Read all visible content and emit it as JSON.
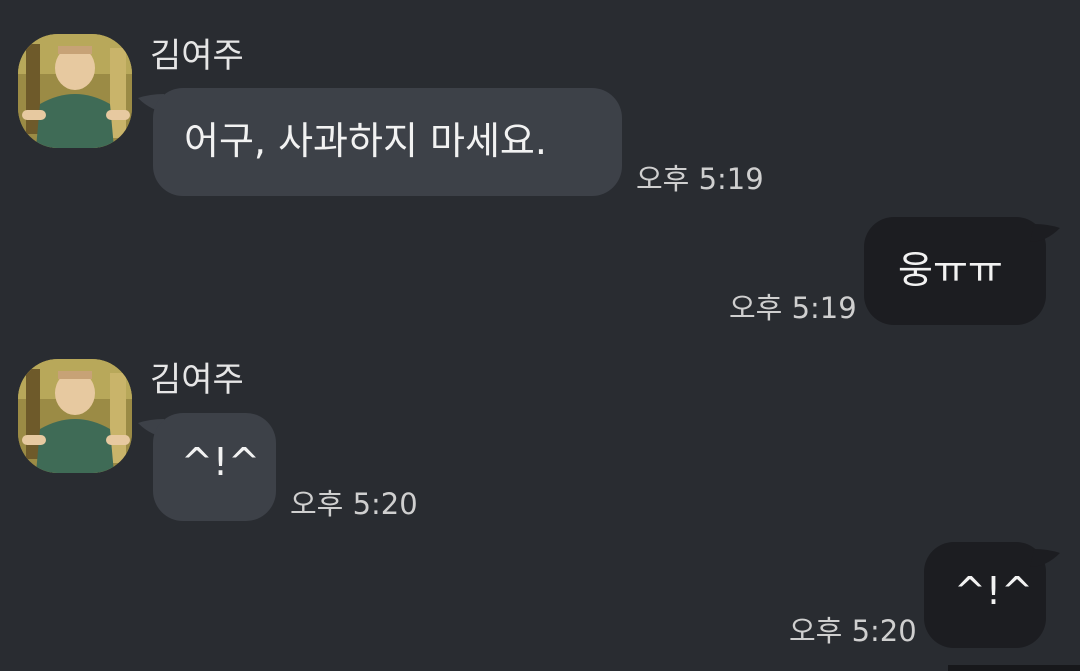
{
  "conversation": {
    "messages": [
      {
        "direction": "incoming",
        "sender": "김여주",
        "avatar_icon": "cartoon-man-avatar",
        "text": "어구, 사과하지 마세요.",
        "time": "오후 5:19"
      },
      {
        "direction": "outgoing",
        "text": "웅ㅠㅠ",
        "time": "오후 5:19"
      },
      {
        "direction": "incoming",
        "sender": "김여주",
        "avatar_icon": "cartoon-man-avatar",
        "text": "^!^",
        "time": "오후 5:20"
      },
      {
        "direction": "outgoing",
        "text": "^!^",
        "time": "오후 5:20"
      }
    ]
  },
  "colors": {
    "background": "#292c31",
    "incoming_bubble": "#3d4148",
    "outgoing_bubble": "#1c1d21",
    "text": "#f2f2f2",
    "timestamp": "#cfcfcf"
  }
}
